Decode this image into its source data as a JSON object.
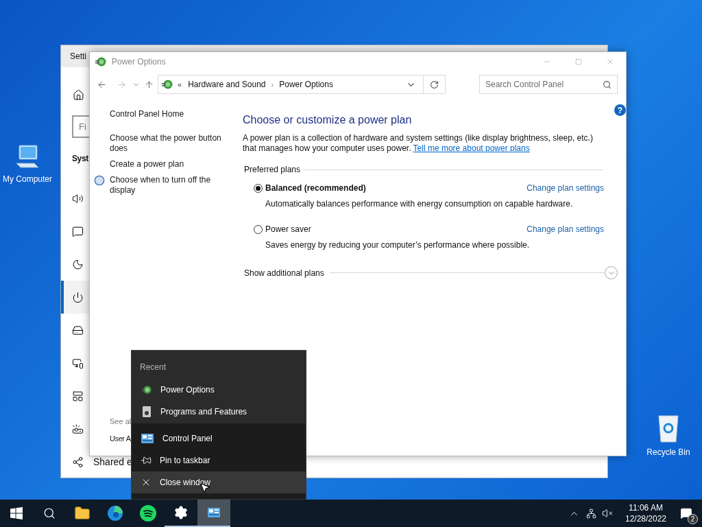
{
  "desktop_icons": [
    {
      "kind": "computer",
      "label": "My Computer"
    },
    {
      "kind": "recycle",
      "label": "Recycle Bin"
    }
  ],
  "settings_window": {
    "title": "Setti",
    "search_placeholder": "Fi",
    "heading": "Syst",
    "nav_items": [
      {
        "kind": "sound",
        "selected": false
      },
      {
        "kind": "notifications",
        "selected": false
      },
      {
        "kind": "sleep",
        "selected": false
      },
      {
        "kind": "power",
        "selected": true
      },
      {
        "kind": "storage",
        "selected": false
      },
      {
        "kind": "tablet",
        "selected": false
      },
      {
        "kind": "multitasking",
        "selected": false
      },
      {
        "kind": "projecting",
        "selected": false
      }
    ],
    "bottom_item": {
      "kind": "shared",
      "label": "Shared e"
    }
  },
  "power_window": {
    "title": "Power Options",
    "breadcrumb_overflow": "«",
    "breadcrumb_separator": "›",
    "help_label": "?",
    "breadcrumb": [
      "Hardware and Sound",
      "Power Options"
    ],
    "search_placeholder": "Search Control Panel",
    "left_links": [
      {
        "label": "Control Panel Home",
        "icon": false
      },
      {
        "label": "Choose what the power button does",
        "icon": false
      },
      {
        "label": "Create a power plan",
        "icon": false
      },
      {
        "label": "Choose when to turn off the display",
        "icon": true
      }
    ],
    "see_also_label": "See al",
    "see_also_links": [
      "User A"
    ],
    "heading": "Choose or customize a power plan",
    "description": "A power plan is a collection of hardware and system settings (like display brightness, sleep, etc.) that manages how your computer uses power.",
    "description_link": "Tell me more about power plans",
    "section_label": "Preferred plans",
    "plans": [
      {
        "name": "Balanced (recommended)",
        "description": "Automatically balances performance with energy consumption on capable hardware.",
        "action": "Change plan settings",
        "selected": true
      },
      {
        "name": "Power saver",
        "description": "Saves energy by reducing your computer’s performance where possible.",
        "action": "Change plan settings",
        "selected": false
      }
    ],
    "more_label": "Show additional plans"
  },
  "jump_list": {
    "header": "Recent",
    "recent": [
      {
        "kind": "power",
        "label": "Power Options"
      },
      {
        "kind": "programs",
        "label": "Programs and Features"
      }
    ],
    "actions": [
      {
        "kind": "app",
        "label": "Control Panel",
        "hovered": false
      },
      {
        "kind": "pin",
        "label": "Pin to taskbar",
        "hovered": false
      },
      {
        "kind": "close",
        "label": "Close window",
        "hovered": true
      }
    ]
  },
  "taskbar": {
    "apps": [
      {
        "kind": "start",
        "running": false,
        "selected": false
      },
      {
        "kind": "search",
        "running": false,
        "selected": false
      },
      {
        "kind": "explorer",
        "running": false,
        "selected": false
      },
      {
        "kind": "edge",
        "running": false,
        "selected": false
      },
      {
        "kind": "spotify",
        "running": false,
        "selected": false
      },
      {
        "kind": "settings",
        "running": true,
        "selected": false
      },
      {
        "kind": "control",
        "running": true,
        "selected": true
      }
    ],
    "time": "11:06 AM",
    "date": "12/28/2022",
    "notification_count": "2",
    "volume_muted": true
  }
}
